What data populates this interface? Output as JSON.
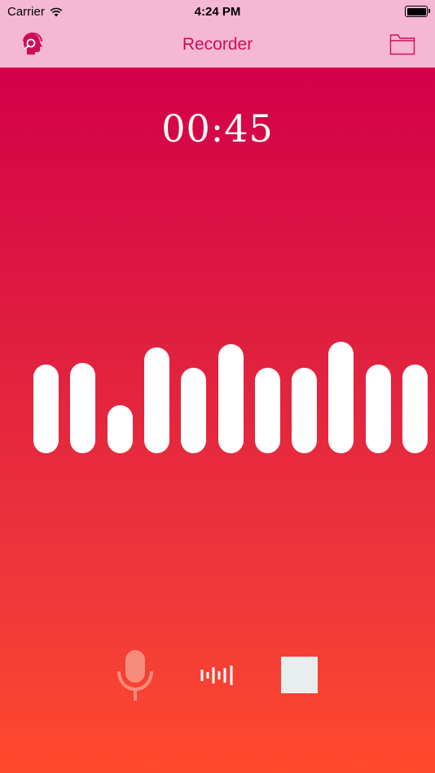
{
  "status_bar": {
    "carrier": "Carrier",
    "time": "4:24 PM"
  },
  "nav": {
    "title": "Recorder",
    "left_icon": "assistant-head-icon",
    "right_icon": "folder-icon"
  },
  "recorder": {
    "elapsed": "00:45",
    "levels": [
      0.52,
      0.53,
      0.28,
      0.62,
      0.5,
      0.64,
      0.5,
      0.5,
      0.65,
      0.52,
      0.52
    ]
  },
  "controls": {
    "record_icon": "microphone-icon",
    "waveform_icon": "waveform-icon",
    "stop_icon": "stop-icon"
  },
  "colors": {
    "nav_background": "#f5b8d3",
    "nav_title": "#cf0c5a",
    "gradient_top": "#d3004a",
    "gradient_bottom": "#ff4a2c",
    "mic_tint": "#f88c7c",
    "stop_fill": "#e8eeee"
  }
}
